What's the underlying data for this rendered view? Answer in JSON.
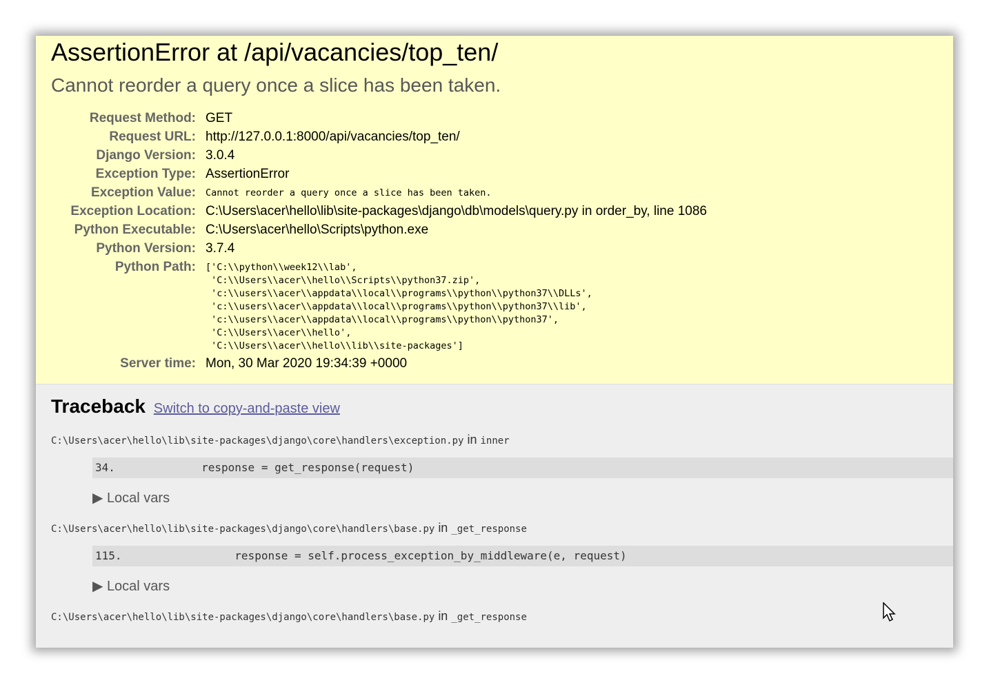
{
  "summary": {
    "title": "AssertionError at /api/vacancies/top_ten/",
    "message": "Cannot reorder a query once a slice has been taken.",
    "rows": [
      {
        "label": "Request Method:",
        "value": "GET"
      },
      {
        "label": "Request URL:",
        "value": "http://127.0.0.1:8000/api/vacancies/top_ten/"
      },
      {
        "label": "Django Version:",
        "value": "3.0.4"
      },
      {
        "label": "Exception Type:",
        "value": "AssertionError"
      },
      {
        "label": "Exception Value:",
        "value": "Cannot reorder a query once a slice has been taken."
      },
      {
        "label": "Exception Location:",
        "value": "C:\\Users\\acer\\hello\\lib\\site-packages\\django\\db\\models\\query.py in order_by, line 1086"
      },
      {
        "label": "Python Executable:",
        "value": "C:\\Users\\acer\\hello\\Scripts\\python.exe"
      },
      {
        "label": "Python Version:",
        "value": "3.7.4"
      },
      {
        "label": "Python Path:",
        "value": "['C:\\\\python\\\\week12\\\\lab',\n 'C:\\\\Users\\\\acer\\\\hello\\\\Scripts\\\\python37.zip',\n 'c:\\\\users\\\\acer\\\\appdata\\\\local\\\\programs\\\\python\\\\python37\\\\DLLs',\n 'c:\\\\users\\\\acer\\\\appdata\\\\local\\\\programs\\\\python\\\\python37\\\\lib',\n 'c:\\\\users\\\\acer\\\\appdata\\\\local\\\\programs\\\\python\\\\python37',\n 'C:\\\\Users\\\\acer\\\\hello',\n 'C:\\\\Users\\\\acer\\\\hello\\\\lib\\\\site-packages']"
      },
      {
        "label": "Server time:",
        "value": "Mon, 30 Mar 2020 19:34:39 +0000"
      }
    ]
  },
  "traceback": {
    "heading": "Traceback",
    "switch_link": "Switch to copy-and-paste view",
    "in_word": "in",
    "local_vars_label": "▶ Local vars",
    "frames": [
      {
        "path": "C:\\Users\\acer\\hello\\lib\\site-packages\\django\\core\\handlers\\exception.py",
        "function": "inner",
        "line": "34.             response = get_response(request)"
      },
      {
        "path": "C:\\Users\\acer\\hello\\lib\\site-packages\\django\\core\\handlers\\base.py",
        "function": "_get_response",
        "line": "115.                 response = self.process_exception_by_middleware(e, request)"
      },
      {
        "path": "C:\\Users\\acer\\hello\\lib\\site-packages\\django\\core\\handlers\\base.py",
        "function": "_get_response",
        "line": ""
      }
    ]
  },
  "colors": {
    "summary_bg": "#ffffc8",
    "body_bg": "#eeeeee",
    "link": "#5b5b9c"
  }
}
